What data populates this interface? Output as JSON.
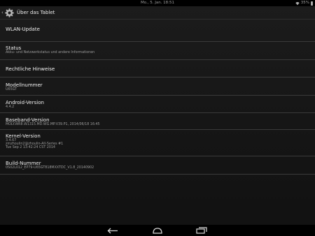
{
  "status_bar": {
    "time": "Mo., 5. Jan. 18:51",
    "battery": "35%"
  },
  "header": {
    "back_icon": "chevron-left-icon",
    "app_icon": "gear-icon",
    "title": "Über das Tablet"
  },
  "items": [
    {
      "title": "WLAN-Update"
    },
    {
      "title": "Status",
      "subtitle": "Akku- und Netzwerkstatus und andere Informationen"
    },
    {
      "title": "Rechtliche Hinweise"
    },
    {
      "title": "Modellnummer",
      "subtitle": "U65GT"
    },
    {
      "title": "Android-Version",
      "subtitle": "4.4.2"
    },
    {
      "title": "Baseband-Version",
      "subtitle": "MOLY.WR8.W1315.MD.WG.MP.V39.P1, 2014/06/18 16:45"
    },
    {
      "title": "Kernel-Version",
      "subtitle": "3.4.67",
      "subtitle2": "zmzhoulin2@zhoulin-All-Series #1",
      "subtitle3": "Tue Sep 2 13:42:24 CST 2014"
    },
    {
      "title": "Build-Nummer",
      "subtitle": "0S02L012_EP79-U65GT818MXXTDC_V1.8_20140902"
    }
  ],
  "nav_bar": {
    "back_icon": "back-arrow-icon",
    "home_icon": "home-icon",
    "recents_icon": "recent-apps-icon"
  },
  "colors": {
    "background": "#181818",
    "divider": "#3a3a3a",
    "text_primary": "#f0f0f0",
    "text_secondary": "#9c9c9c"
  }
}
